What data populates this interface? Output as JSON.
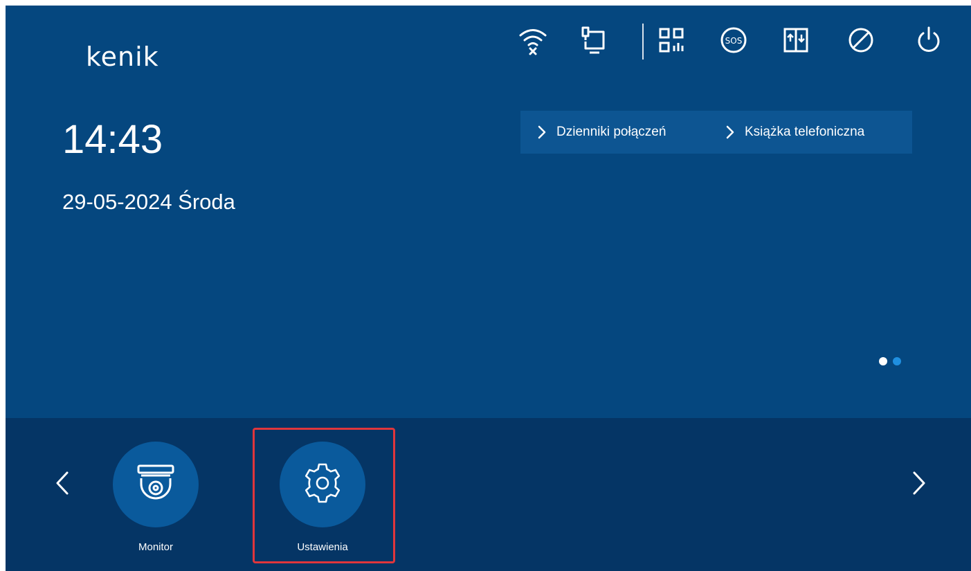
{
  "brand": {
    "logo_text": "kenik"
  },
  "status_icons": [
    {
      "name": "wifi-disconnected-icon"
    },
    {
      "name": "network-monitor-icon"
    },
    {
      "name": "qr-code-icon"
    },
    {
      "name": "sos-icon"
    },
    {
      "name": "elevator-icon"
    },
    {
      "name": "do-not-disturb-icon"
    },
    {
      "name": "power-icon"
    }
  ],
  "home": {
    "time": "14:43",
    "date": "29-05-2024 Środa"
  },
  "quick_links": [
    {
      "label": "Dzienniki połączeń",
      "icon": "chevron-right-icon"
    },
    {
      "label": "Książka telefoniczna",
      "icon": "chevron-right-icon"
    }
  ],
  "pager": {
    "current_page": 1,
    "total_pages": 2
  },
  "dock": {
    "apps": [
      {
        "label": "Monitor",
        "icon": "dome-camera-icon"
      },
      {
        "label": "Ustawienia",
        "icon": "gear-icon"
      }
    ],
    "highlighted_app": "Ustawienia"
  },
  "colors": {
    "background": "#05477f",
    "dock_background": "#053565",
    "app_circle": "#0a5a9c",
    "quick_links_bar": "#0d5592",
    "highlight": "#e0363c",
    "pager_inactive": "#1f8fe0"
  }
}
